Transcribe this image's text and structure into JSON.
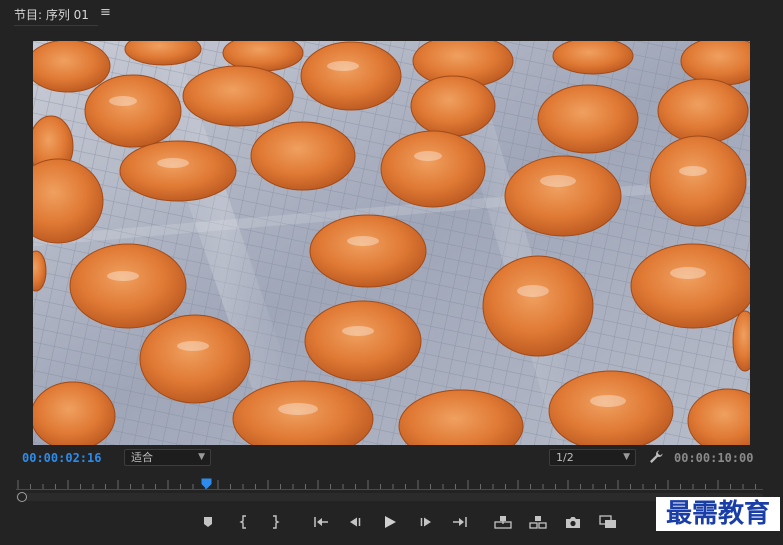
{
  "panel": {
    "title": "节目: 序列 01",
    "menu_glyph": "≡"
  },
  "timecode": {
    "current": "00:00:02:16",
    "duration": "00:00:10:00"
  },
  "zoom_select": {
    "value": "适合"
  },
  "resolution_select": {
    "value": "1/2"
  },
  "playhead_position": 0.254,
  "icons": {
    "settings": "wrench-icon",
    "marker": "marker-icon",
    "mark_in": "mark-in-icon",
    "mark_out": "mark-out-icon",
    "go_to_in": "go-to-in-icon",
    "step_back": "step-back-icon",
    "play": "play-icon",
    "step_forward": "step-forward-icon",
    "go_to_out": "go-to-out-icon",
    "lift": "lift-icon",
    "extract": "extract-icon",
    "export_frame": "camera-icon",
    "compare": "compare-view-icon"
  },
  "colors": {
    "timecode_accent": "#2d8ceb",
    "panel_bg": "#232323"
  },
  "watermark": {
    "text": "最需教育"
  }
}
